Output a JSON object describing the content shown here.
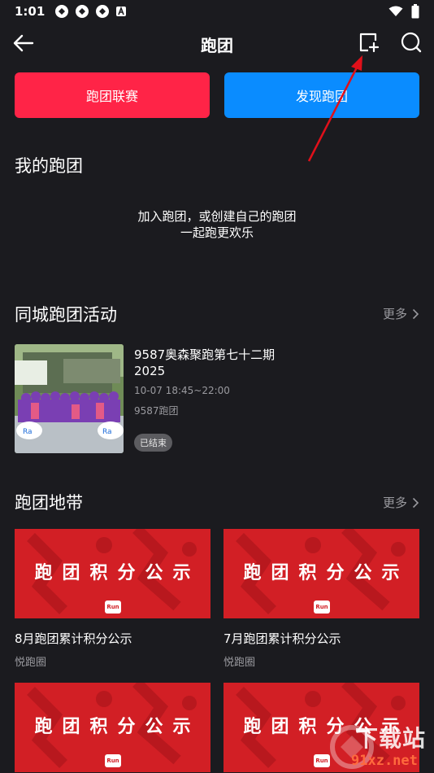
{
  "status_bar": {
    "time": "1:01"
  },
  "header": {
    "title": "跑团"
  },
  "buttons": {
    "league": "跑团联赛",
    "discover": "发现跑团"
  },
  "my_clubs": {
    "title": "我的跑团",
    "empty_line1": "加入跑团，或创建自己的跑团",
    "empty_line2": "一起跑更欢乐"
  },
  "city_activities": {
    "title": "同城跑团活动",
    "more": "更多",
    "items": [
      {
        "title": "9587奥森聚跑第七十二期2025",
        "time": "10-07 18:45~22:00",
        "club": "9587跑团",
        "status": "已结束"
      }
    ]
  },
  "club_zone": {
    "title": "跑团地带",
    "more": "更多",
    "posts": [
      {
        "banner": "跑团积分公示",
        "logo": "Run",
        "title": "8月跑团累计积分公示",
        "author": "悦跑圈"
      },
      {
        "banner": "跑团积分公示",
        "logo": "Run",
        "title": "7月跑团累计积分公示",
        "author": "悦跑圈"
      },
      {
        "banner": "跑团积分公示",
        "logo": "Run"
      },
      {
        "banner": "跑团积分公示",
        "logo": "Run"
      }
    ]
  },
  "watermark": {
    "top": "下载站",
    "bottom": "91xz.net"
  },
  "colors": {
    "league": "#ff2447",
    "discover": "#0a8cff",
    "banner": "#d21f25",
    "background": "#1b1b1f"
  }
}
